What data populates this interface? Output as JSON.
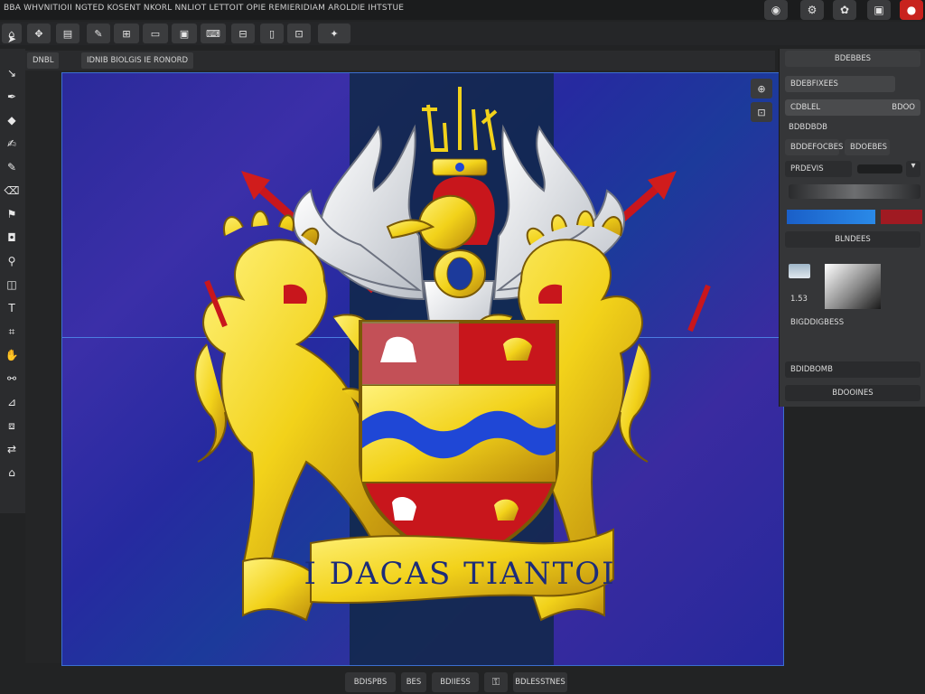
{
  "menubar": {
    "text": "BBA WHVNITIOII NGTED KOSENT NKORL NNLIOT LETTOIT OPIE REMIERIDIAM AROLDIE IHTSTUE",
    "window_buttons": [
      {
        "icon": "camera-icon",
        "glyph": "◉"
      },
      {
        "icon": "settings-icon",
        "glyph": "⚙"
      },
      {
        "icon": "gear-icon",
        "glyph": "✿"
      },
      {
        "icon": "print-icon",
        "glyph": "▣"
      },
      {
        "icon": "close-icon",
        "glyph": "●"
      }
    ]
  },
  "toolbar": {
    "buttons": [
      {
        "icon": "home-icon",
        "glyph": "⌂",
        "label": ""
      },
      {
        "icon": "move-icon",
        "glyph": "✥",
        "label": ""
      },
      {
        "icon": "layers-icon",
        "glyph": "▤",
        "label": ""
      },
      {
        "icon": "brush-icon",
        "glyph": "✎",
        "label": ""
      },
      {
        "icon": "image-icon",
        "glyph": "⊞",
        "label": ""
      },
      {
        "icon": "screen-icon",
        "glyph": "▭",
        "label": ""
      },
      {
        "icon": "monitor-icon",
        "glyph": "▣",
        "label": ""
      },
      {
        "icon": "keyboard-icon",
        "glyph": "⌨",
        "label": ""
      },
      {
        "icon": "grid-icon",
        "glyph": "⊟",
        "label": ""
      },
      {
        "icon": "document-icon",
        "glyph": "▯",
        "label": ""
      },
      {
        "icon": "frame-icon",
        "glyph": "⊡",
        "label": ""
      },
      {
        "icon": "wand-icon",
        "glyph": "✦",
        "label": ""
      },
      {
        "icon": "export-icon",
        "glyph": "⇪",
        "label": ""
      }
    ]
  },
  "tabs": [
    {
      "label": "DNBL"
    },
    {
      "label": "IDNIB BIOLGIS IE RONORD"
    }
  ],
  "left_tools": [
    {
      "icon": "select-icon",
      "glyph": "➤"
    },
    {
      "icon": "direct-select-icon",
      "glyph": "↘"
    },
    {
      "icon": "pen-icon",
      "glyph": "✒"
    },
    {
      "icon": "shape-icon",
      "glyph": "◆"
    },
    {
      "icon": "paint-icon",
      "glyph": "✍"
    },
    {
      "icon": "brush-tool-icon",
      "glyph": "✎"
    },
    {
      "icon": "eraser-icon",
      "glyph": "⌫"
    },
    {
      "icon": "stamp-icon",
      "glyph": "⚑"
    },
    {
      "icon": "fill-icon",
      "glyph": "◘"
    },
    {
      "icon": "eyedropper-icon",
      "glyph": "⚲"
    },
    {
      "icon": "gradient-icon",
      "glyph": "◫"
    },
    {
      "icon": "text-tool-icon",
      "glyph": "T"
    },
    {
      "icon": "crop-icon",
      "glyph": "⌗"
    },
    {
      "icon": "hand-icon",
      "glyph": "✋"
    },
    {
      "icon": "zoom-icon",
      "glyph": "⚯"
    },
    {
      "icon": "measure-icon",
      "glyph": "⊿"
    },
    {
      "icon": "slice-icon",
      "glyph": "⧈"
    },
    {
      "icon": "swap-icon",
      "glyph": "⇄"
    }
  ],
  "canvas": {
    "motto": "I DACAS TIANTOI",
    "mini_buttons": [
      {
        "icon": "zoom-in-icon",
        "glyph": "⊕"
      },
      {
        "icon": "fit-screen-icon",
        "glyph": "⊡"
      }
    ]
  },
  "right_panel": {
    "header": "BDEBBES",
    "field_1": "BDEBFIXEES",
    "slider_1_label": "CDBLEL",
    "slider_1_value": "BDOO",
    "section_label": "BDBDBDB",
    "buttons": [
      "BDDEFOCBES",
      "BDOEBES"
    ],
    "preset_label": "PRDEVIS",
    "color_primary": "#2a72d8",
    "color_secondary": "#a01a22",
    "layers_label": "BLNDEES",
    "size_label": "1.53",
    "swatch_label": "BIGDDIGBESS",
    "opacity_label": "BDIDBOMB",
    "footer_button": "BDOOINES"
  },
  "bottom_bar": {
    "buttons": [
      {
        "label": "BDISPBS"
      },
      {
        "label": "BES"
      },
      {
        "label": "BDIIESS"
      },
      {
        "label": "",
        "icon": "lock-icon",
        "glyph": "⚿"
      },
      {
        "label": "BDLESSTNES"
      }
    ]
  },
  "colors": {
    "background": "#222324",
    "artboard_border": "#3b6fd0",
    "gold": "#f2d21a",
    "shield_red": "#c8161c",
    "wave_blue": "#1f47d6"
  }
}
